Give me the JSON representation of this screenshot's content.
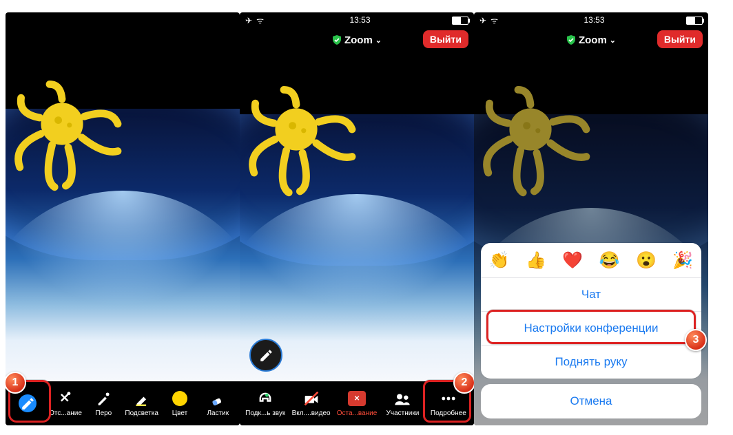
{
  "status": {
    "time": "13:53"
  },
  "header": {
    "app": "Zoom",
    "leave": "Выйти"
  },
  "screen1": {
    "toolbar": [
      {
        "name": "annotate-button",
        "label": "",
        "kind": "circleBlue"
      },
      {
        "name": "spotlight-button",
        "label": "Отс...ание",
        "kind": "spotlight"
      },
      {
        "name": "pen-button",
        "label": "Перо",
        "kind": "pen"
      },
      {
        "name": "highlight-button",
        "label": "Подсветка",
        "kind": "highlight"
      },
      {
        "name": "color-button",
        "label": "Цвет",
        "kind": "colorDot"
      },
      {
        "name": "eraser-button",
        "label": "Ластик",
        "kind": "eraser"
      }
    ]
  },
  "screen2": {
    "toolbar": [
      {
        "name": "audio-button",
        "label": "Подк...ь звук",
        "kind": "headset"
      },
      {
        "name": "video-button",
        "label": "Вкл....видео",
        "kind": "videoOff"
      },
      {
        "name": "stop-share-button",
        "label": "Оста...вание",
        "kind": "stop",
        "red": true
      },
      {
        "name": "participants-button",
        "label": "Участники",
        "kind": "people"
      },
      {
        "name": "more-button",
        "label": "Подробнее",
        "kind": "more"
      }
    ]
  },
  "screen3": {
    "emojis": [
      "👏",
      "👍",
      "❤️",
      "😂",
      "😮",
      "🎉"
    ],
    "rows": [
      {
        "name": "chat-row",
        "label": "Чат"
      },
      {
        "name": "meeting-settings-row",
        "label": "Настройки конференции"
      },
      {
        "name": "raise-hand-row",
        "label": "Поднять руку"
      }
    ],
    "cancel": "Отмена"
  },
  "callouts": {
    "b1": "1",
    "b2": "2",
    "b3": "3"
  }
}
